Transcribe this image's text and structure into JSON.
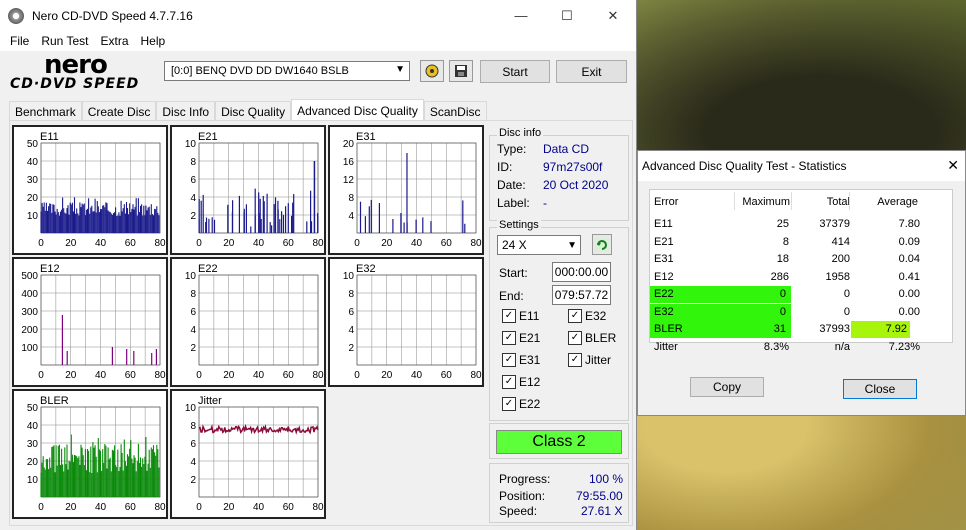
{
  "window": {
    "title": "Nero CD-DVD Speed 4.7.7.16",
    "min": "—",
    "max": "☐",
    "close": "✕"
  },
  "menu": [
    "File",
    "Run Test",
    "Extra",
    "Help"
  ],
  "logo": {
    "top": "nero",
    "bottom": "CD·DVD SPEED"
  },
  "drive": {
    "value": "[0:0]   BENQ DVD DD DW1640 BSLB"
  },
  "buttons": {
    "start": "Start",
    "exit": "Exit"
  },
  "tabs": [
    "Benchmark",
    "Create Disc",
    "Disc Info",
    "Disc Quality",
    "Advanced Disc Quality",
    "ScanDisc"
  ],
  "active_tab": "Advanced Disc Quality",
  "graphs": [
    {
      "name": "E11",
      "yticks": [
        "50",
        "40",
        "30",
        "20",
        "10"
      ],
      "xticks": [
        "0",
        "20",
        "40",
        "60",
        "80"
      ],
      "color": "#1a1a8c",
      "kind": "dense"
    },
    {
      "name": "E21",
      "yticks": [
        "10",
        "8",
        "6",
        "4",
        "2"
      ],
      "xticks": [
        "0",
        "20",
        "40",
        "60",
        "80"
      ],
      "color": "#1a1a8c",
      "kind": "sparse"
    },
    {
      "name": "E31",
      "yticks": [
        "20",
        "16",
        "12",
        "8",
        "4"
      ],
      "xticks": [
        "0",
        "20",
        "40",
        "60",
        "80"
      ],
      "color": "#1a1a8c",
      "kind": "sparse2"
    },
    {
      "name": "E12",
      "yticks": [
        "500",
        "400",
        "300",
        "200",
        "100"
      ],
      "xticks": [
        "0",
        "20",
        "40",
        "60",
        "80"
      ],
      "color": "#800080",
      "kind": "spikes"
    },
    {
      "name": "E22",
      "yticks": [
        "10",
        "8",
        "6",
        "4",
        "2"
      ],
      "xticks": [
        "0",
        "20",
        "40",
        "60",
        "80"
      ],
      "color": "#1a1a8c",
      "kind": "empty"
    },
    {
      "name": "E32",
      "yticks": [
        "10",
        "8",
        "6",
        "4",
        "2"
      ],
      "xticks": [
        "0",
        "20",
        "40",
        "60",
        "80"
      ],
      "color": "#1a1a8c",
      "kind": "empty"
    },
    {
      "name": "BLER",
      "yticks": [
        "50",
        "40",
        "30",
        "20",
        "10"
      ],
      "xticks": [
        "0",
        "20",
        "40",
        "60",
        "80"
      ],
      "color": "#0a8a0a",
      "kind": "bler"
    },
    {
      "name": "Jitter",
      "yticks": [
        "10",
        "8",
        "6",
        "4",
        "2"
      ],
      "xticks": [
        "0",
        "20",
        "40",
        "60",
        "80"
      ],
      "color": "#8b0a3a",
      "kind": "jitter"
    }
  ],
  "disc_info": {
    "title": "Disc info",
    "type_label": "Type:",
    "type": "Data CD",
    "id_label": "ID:",
    "id": "97m27s00f",
    "date_label": "Date:",
    "date": "20 Oct 2020",
    "label_label": "Label:",
    "label": "-"
  },
  "settings": {
    "title": "Settings",
    "speed": "24 X",
    "start_label": "Start:",
    "start": "000:00.00",
    "end_label": "End:",
    "end": "079:57.72",
    "checks": [
      {
        "label": "E11",
        "checked": true
      },
      {
        "label": "E32",
        "checked": true
      },
      {
        "label": "E21",
        "checked": true
      },
      {
        "label": "BLER",
        "checked": true
      },
      {
        "label": "E31",
        "checked": true
      },
      {
        "label": "Jitter",
        "checked": true
      },
      {
        "label": "E12",
        "checked": true
      },
      {
        "label": "E22",
        "checked": true
      }
    ]
  },
  "class": "Class 2",
  "progress": {
    "progress_label": "Progress:",
    "progress": "100 %",
    "position_label": "Position:",
    "position": "79:55.00",
    "speed_label": "Speed:",
    "speed": "27.61 X"
  },
  "stats": {
    "title": "Advanced Disc Quality Test - Statistics",
    "close": "✕",
    "headers": [
      "Error",
      "Maximum",
      "Total",
      "Average"
    ],
    "rows": [
      {
        "error": "E11",
        "maximum": "25",
        "total": "37379",
        "average": "7.80",
        "hl": ""
      },
      {
        "error": "E21",
        "maximum": "8",
        "total": "414",
        "average": "0.09",
        "hl": ""
      },
      {
        "error": "E31",
        "maximum": "18",
        "total": "200",
        "average": "0.04",
        "hl": ""
      },
      {
        "error": "E12",
        "maximum": "286",
        "total": "1958",
        "average": "0.41",
        "hl": ""
      },
      {
        "error": "E22",
        "maximum": "0",
        "total": "0",
        "average": "0.00",
        "hl": "green"
      },
      {
        "error": "E32",
        "maximum": "0",
        "total": "0",
        "average": "0.00",
        "hl": "green"
      },
      {
        "error": "BLER",
        "maximum": "31",
        "total": "37993",
        "average": "7.92",
        "hl": "bler"
      },
      {
        "error": "Jitter",
        "maximum": "8.3%",
        "total": "n/a",
        "average": "7.23%",
        "hl": ""
      }
    ],
    "copy": "Copy",
    "close_btn": "Close"
  }
}
